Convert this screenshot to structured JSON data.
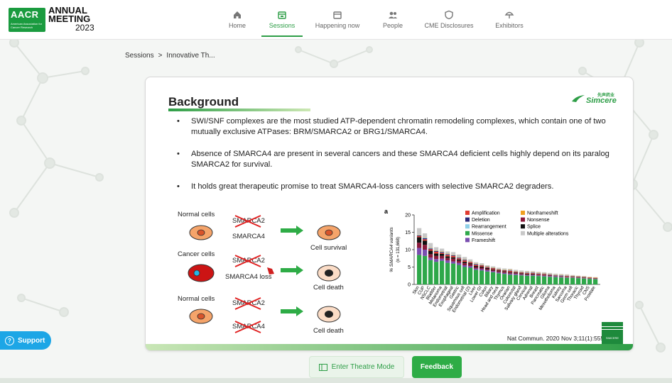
{
  "logo": {
    "badge": "AACR",
    "badge_sub": "American Association for Cancer Research",
    "line1": "ANNUAL",
    "line2": "MEETING",
    "year": "2023"
  },
  "nav": {
    "items": [
      {
        "label": "Home",
        "icon": "home-icon",
        "active": false
      },
      {
        "label": "Sessions",
        "icon": "calendar-icon",
        "active": true
      },
      {
        "label": "Happening now",
        "icon": "calendar-icon",
        "active": false
      },
      {
        "label": "People",
        "icon": "people-icon",
        "active": false
      },
      {
        "label": "CME Disclosures",
        "icon": "shield-icon",
        "active": false
      },
      {
        "label": "Exhibitors",
        "icon": "umbrella-icon",
        "active": false
      }
    ]
  },
  "breadcrumb": {
    "root": "Sessions",
    "separator": ">",
    "current": "Innovative Th..."
  },
  "slide": {
    "title": "Background",
    "brand_cn": "先声药业",
    "brand": "Simcere",
    "bullets": [
      "SWI/SNF complexes are the most studied ATP-dependent chromatin remodeling complexes, which contain one of two mutually exclusive ATPases: BRM/SMARCA2 or BRG1/SMARCA4.",
      "Absence of SMARCA4 are present in several cancers and these SMARCA4 deficient cells highly depend on its paralog SMARCA2 for survival.",
      "It holds great therapeutic promise to treat SMARCA4-loss cancers with selective SMARCA2 degraders."
    ],
    "diagram": {
      "row1": {
        "label": "Normal cells",
        "gene_top": "SMARCA2",
        "gene_bottom": "SMARCA4",
        "outcome": "Cell survival"
      },
      "row2": {
        "label": "Cancer cells",
        "gene_top": "SMARCA2",
        "gene_bottom": "SMARCA4 loss",
        "outcome": "Cell death"
      },
      "row3": {
        "label": "Normal cells",
        "gene_top": "SMARCA2",
        "gene_bottom": "SMARCA4",
        "outcome": "Cell death"
      }
    },
    "citation": "Nat Commun. 2020 Nov 3;11(1):5551",
    "corner_badge": "SIMCERE"
  },
  "chart_data": {
    "type": "bar",
    "panel_label": "a",
    "ylabel": "% SMARCA4 variants",
    "ylabel2": "(n = 131,668)",
    "ylim": [
      0,
      20
    ],
    "yticks": [
      0,
      5,
      10,
      15,
      20
    ],
    "categories": [
      "Skin",
      "CUP",
      "NSCLC",
      "Bladder",
      "Melanoma",
      "Endometrial",
      "Esophageal",
      "Gastric",
      "Squamous cell",
      "Endometrial (2)",
      "Liver",
      "Lower GI",
      "Colon",
      "Biliary",
      "Head and neck",
      "Thymus",
      "Ovarian",
      "Colorectal",
      "Salivary gland",
      "Cervical",
      "Adrenal",
      "Breast",
      "Pancreatic",
      "Glioma",
      "Mesothelioma",
      "Kidney",
      "Sarcoma",
      "Germ cell",
      "Thoracic",
      "Thyroid",
      "CNS",
      "Prostate"
    ],
    "series": [
      {
        "name": "Amplification",
        "color": "#e03c31",
        "values": [
          0.3,
          0.4,
          0.4,
          0.5,
          0.3,
          0.4,
          0.4,
          0.3,
          0.4,
          0.3,
          0.3,
          0.3,
          0.2,
          0.3,
          0.2,
          0.2,
          0.3,
          0.2,
          0.2,
          0.2,
          0.2,
          0.2,
          0.2,
          0.1,
          0.1,
          0.1,
          0.2,
          0.1,
          0.1,
          0.1,
          0.1,
          0.1
        ]
      },
      {
        "name": "Deletion",
        "color": "#2b2a7a",
        "values": [
          0.2,
          0.3,
          0.2,
          0.2,
          0.2,
          0.2,
          0.2,
          0.2,
          0.2,
          0.1,
          0.2,
          0.1,
          0.1,
          0.1,
          0.1,
          0.1,
          0.1,
          0.1,
          0.1,
          0.1,
          0.1,
          0.1,
          0.1,
          0.1,
          0.1,
          0.1,
          0.1,
          0.1,
          0.1,
          0.1,
          0.0,
          0.0
        ]
      },
      {
        "name": "Rearrangement",
        "color": "#8fd0e8",
        "values": [
          0.1,
          0.2,
          0.2,
          0.1,
          0.1,
          0.1,
          0.1,
          0.1,
          0.1,
          0.1,
          0.1,
          0.1,
          0.1,
          0.1,
          0.1,
          0.1,
          0.1,
          0.1,
          0.1,
          0.1,
          0.1,
          0.1,
          0.1,
          0.1,
          0.1,
          0.1,
          0.1,
          0.0,
          0.0,
          0.0,
          0.0,
          0.0
        ]
      },
      {
        "name": "Missense",
        "color": "#2ea84a",
        "values": [
          8.5,
          8.2,
          7.0,
          6.5,
          6.8,
          6.2,
          6.0,
          5.6,
          5.0,
          4.8,
          4.2,
          4.0,
          3.7,
          3.5,
          3.2,
          3.0,
          2.8,
          2.7,
          2.6,
          2.5,
          2.5,
          2.4,
          2.3,
          2.2,
          2.1,
          2.0,
          1.9,
          1.9,
          1.8,
          1.7,
          1.6,
          1.5
        ]
      },
      {
        "name": "Frameshift",
        "color": "#7a4fb0",
        "values": [
          2.0,
          1.8,
          0.7,
          0.8,
          0.6,
          0.7,
          0.6,
          0.6,
          0.5,
          0.5,
          0.4,
          0.4,
          0.4,
          0.3,
          0.3,
          0.3,
          0.3,
          0.3,
          0.2,
          0.2,
          0.2,
          0.2,
          0.2,
          0.2,
          0.2,
          0.2,
          0.1,
          0.1,
          0.1,
          0.1,
          0.1,
          0.1
        ]
      },
      {
        "name": "Nonframeshift",
        "color": "#f0a020",
        "values": [
          0.1,
          0.1,
          0.1,
          0.1,
          0.1,
          0.1,
          0.1,
          0.1,
          0.1,
          0.1,
          0.1,
          0.1,
          0.1,
          0.1,
          0.1,
          0.1,
          0.1,
          0.1,
          0.1,
          0.1,
          0.1,
          0.1,
          0.1,
          0.1,
          0.1,
          0.1,
          0.1,
          0.1,
          0.1,
          0.1,
          0.1,
          0.1
        ]
      },
      {
        "name": "Nonsense",
        "color": "#8b1a3a",
        "values": [
          1.5,
          1.4,
          1.0,
          0.9,
          0.8,
          0.7,
          0.8,
          0.6,
          0.6,
          0.5,
          0.4,
          0.4,
          0.3,
          0.3,
          0.3,
          0.3,
          0.3,
          0.2,
          0.2,
          0.2,
          0.2,
          0.2,
          0.2,
          0.2,
          0.1,
          0.1,
          0.1,
          0.1,
          0.1,
          0.1,
          0.1,
          0.1
        ]
      },
      {
        "name": "Splice",
        "color": "#111111",
        "values": [
          1.6,
          1.2,
          1.0,
          0.7,
          0.6,
          0.5,
          0.4,
          0.4,
          0.4,
          0.3,
          0.3,
          0.3,
          0.3,
          0.2,
          0.2,
          0.2,
          0.2,
          0.2,
          0.2,
          0.2,
          0.2,
          0.1,
          0.1,
          0.1,
          0.1,
          0.1,
          0.1,
          0.1,
          0.1,
          0.1,
          0.1,
          0.1
        ]
      },
      {
        "name": "Multiple alterations",
        "color": "#c8c8c8",
        "values": [
          1.9,
          1.1,
          1.3,
          0.9,
          0.8,
          0.6,
          0.7,
          0.7,
          0.6,
          0.5,
          0.4,
          0.4,
          0.3,
          0.3,
          0.3,
          0.3,
          0.3,
          0.3,
          0.3,
          0.3,
          0.2,
          0.2,
          0.2,
          0.2,
          0.2,
          0.2,
          0.2,
          0.2,
          0.1,
          0.1,
          0.1,
          0.1
        ]
      }
    ],
    "legend_position": "top-right",
    "grid": false
  },
  "buttons": {
    "theatre": "Enter Theatre Mode",
    "feedback": "Feedback",
    "support": "Support",
    "support_icon": "?"
  }
}
